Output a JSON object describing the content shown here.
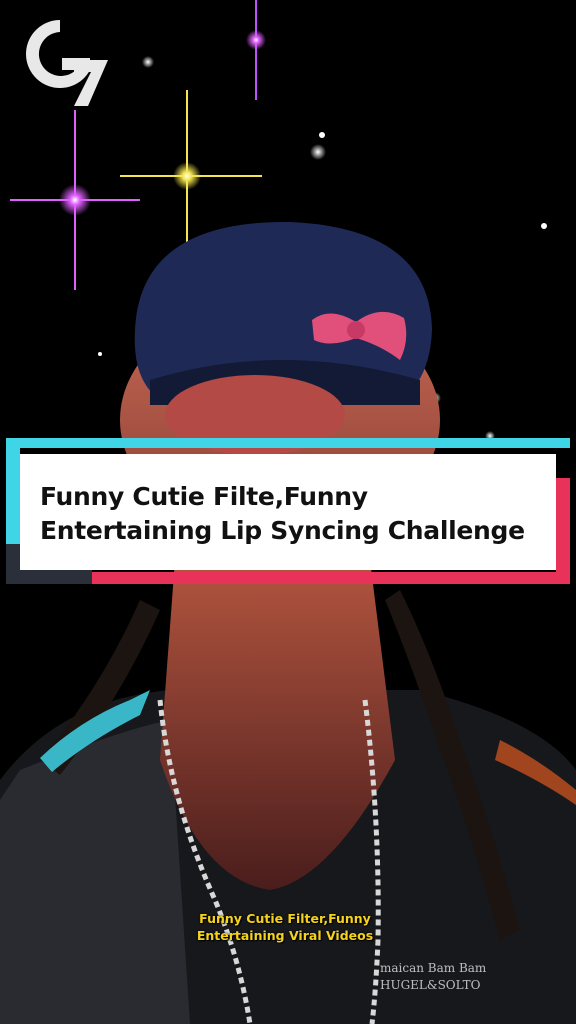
{
  "logo": {
    "text": "G7"
  },
  "banner": {
    "title": "Funny Cutie Filte,Funny\nEntertaining Lip Syncing Challenge"
  },
  "video": {
    "caption": "Funny Cutie Filter,Funny\nEntertaining Viral Videos",
    "watermark": "maican Bam Bam\nHUGEL&SOLTO"
  },
  "colors": {
    "cyan_accent": "#3fd4e6",
    "pink_accent": "#e8325a",
    "caption_yellow": "#f5d31c",
    "background": "#000000"
  }
}
